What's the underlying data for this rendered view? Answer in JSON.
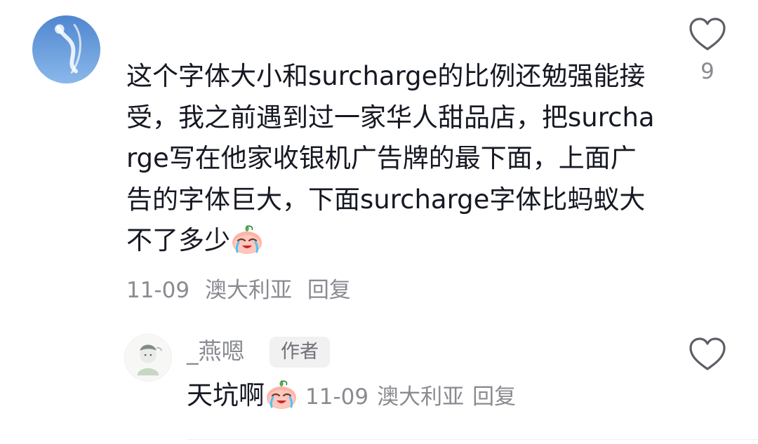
{
  "comment": {
    "text_before_emoji": "这个字体大小和surcharge的比例还勉强能接受，我之前遇到过一家华人甜品店，把surcharge写在他家收银机广告牌的最下面，上面广告的字体巨大，下面surcharge字体比蚂蚁大不了多少",
    "emoji": "crying-face-emoji",
    "date": "11-09",
    "location": "澳大利亚",
    "reply_label": "回复",
    "like_count": "9",
    "like_icon": "heart-outline-icon"
  },
  "reply": {
    "username": "_燕嗯",
    "badge": "作者",
    "text": "天坑啊",
    "emoji": "crying-face-emoji",
    "date": "11-09",
    "location": "澳大利亚",
    "reply_label": "回复",
    "like_icon": "heart-outline-icon"
  },
  "colors": {
    "text_primary": "#161823",
    "text_secondary": "#8a8b91",
    "badge_bg": "#f1f1f2",
    "avatar_sky": "#6b9fd8"
  }
}
